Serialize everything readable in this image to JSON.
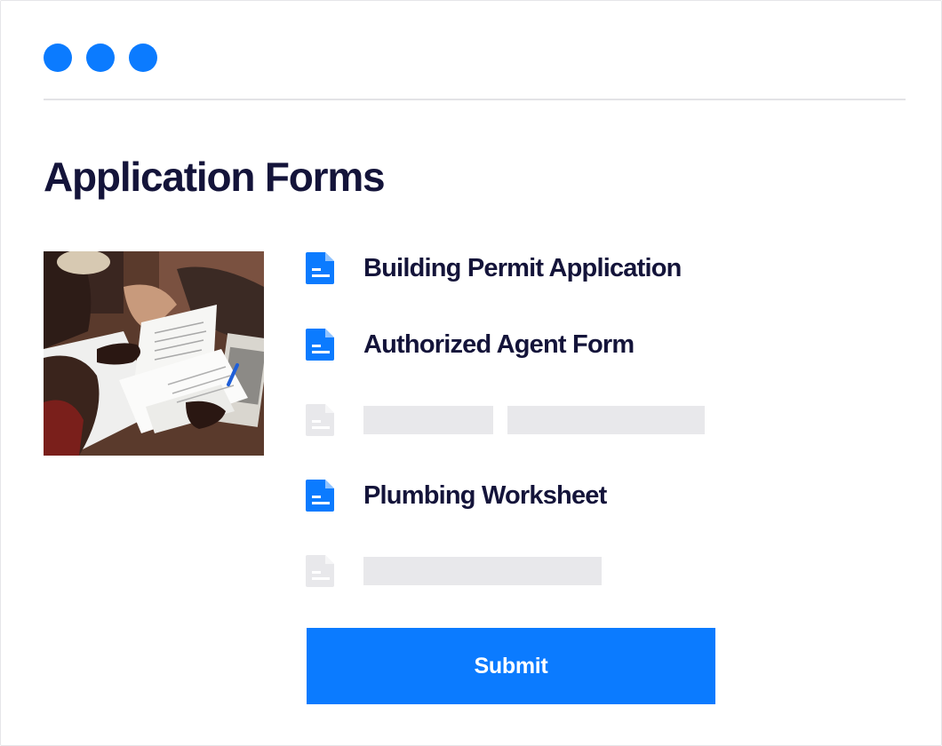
{
  "window": {
    "controls": [
      "window-dot",
      "window-dot",
      "window-dot"
    ],
    "accent_color": "#0b7bff"
  },
  "page": {
    "title": "Application Forms"
  },
  "photo": {
    "description_icon": "people-reviewing-documents-photo"
  },
  "forms": [
    {
      "label": "Building Permit Application",
      "state": "available",
      "icon": "document-icon"
    },
    {
      "label": "Authorized Agent Form",
      "state": "available",
      "icon": "document-icon"
    },
    {
      "label": "",
      "state": "placeholder",
      "icon": "document-icon"
    },
    {
      "label": "Plumbing Worksheet",
      "state": "available",
      "icon": "document-icon"
    },
    {
      "label": "",
      "state": "placeholder",
      "icon": "document-icon"
    }
  ],
  "colors": {
    "primary": "#0b7bff",
    "title_text": "#14143a",
    "placeholder": "#e8e8eb",
    "disabled_icon": "#e8e8eb"
  },
  "submit": {
    "label": "Submit"
  }
}
